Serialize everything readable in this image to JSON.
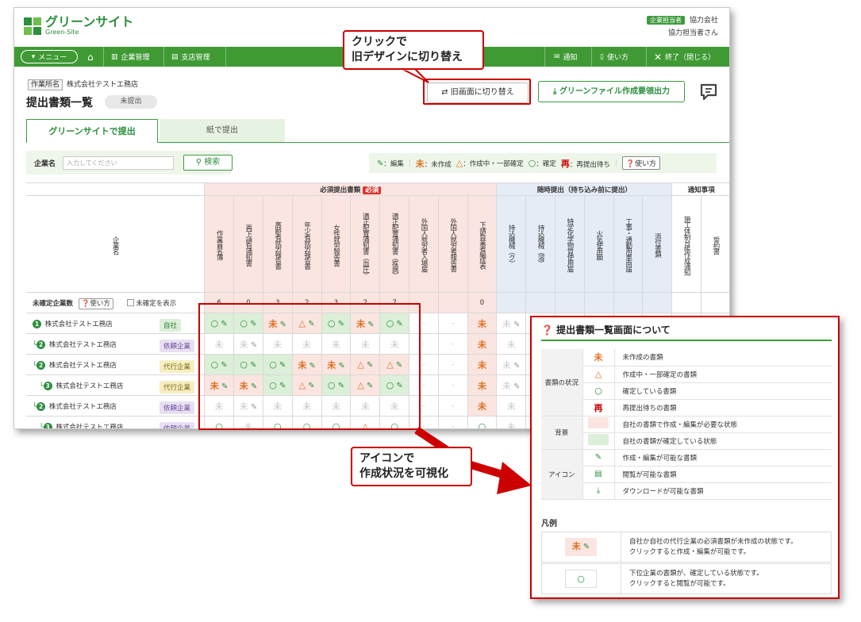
{
  "app": {
    "logo_text": "グリーンサイト",
    "logo_sub": "Green-Site",
    "brand_color": "#3f9a34"
  },
  "user": {
    "role_badge": "企業担当者",
    "company": "協力会社",
    "name": "協力担当者さん"
  },
  "nav": {
    "menu": "メニュー",
    "items": [
      "企業管理",
      "支店管理"
    ],
    "notify": "通知",
    "howto": "使い方",
    "exit": "終了（閉じる）"
  },
  "page": {
    "ws_label": "作業所名",
    "ws_name": "株式会社テストエ務店",
    "title": "提出書類一覧",
    "status": "未提出",
    "btn_old": "旧画面に切り替え",
    "btn_gf": "グリーンファイル作成要領出力"
  },
  "tabs": [
    "グリーンサイトで提出",
    "紙で提出"
  ],
  "search": {
    "label": "企業名",
    "placeholder": "入力してください",
    "button": "検索"
  },
  "legend": {
    "edit": "：編集",
    "mi": "未",
    "mi_label": "：未作成",
    "tri_label": "：作成中・一部確定",
    "ok_label": "：確定",
    "re": "再",
    "re_label": "：再提出待ち",
    "help": "使い方"
  },
  "grid": {
    "groups": {
      "required": "必須提出書類",
      "required_badge": "必須",
      "optional": "随時提出（持ち込み前に提出）",
      "notify": "通知事項"
    },
    "company_col": "企業名",
    "unconfirmed_label": "未確定企業数",
    "howto": "使い方",
    "show_unconfirmed": "未確定を表示",
    "columns": [
      "作業員名簿",
      "再下請負通知書",
      "高齢者就労報告書",
      "年少者就労報告書",
      "女性就労報告書",
      "適正配置通知書（血圧）",
      "適正配置通知書（疾病）",
      "外国人就労者入場届",
      "外国人就労者報告書",
      "下請負業者編成表",
      "持込機械（ク）",
      "持込機械（溶）",
      "特定化学物質使用届",
      "火気使用願",
      "工事・通勤用車両届",
      "添付書類",
      "施工体制台帳作成通知",
      "誓約書"
    ],
    "counts": [
      "6",
      "0",
      "3",
      "2",
      "3",
      "2",
      "7",
      "",
      "",
      "0",
      "",
      "",
      "",
      "",
      "",
      "",
      "",
      ""
    ],
    "rows": [
      {
        "num": "1",
        "indent": "",
        "name": "株式会社テストエ務店",
        "tag": "自社",
        "tagtype": "self",
        "cells": [
          [
            "o",
            "p",
            "g"
          ],
          [
            "o",
            "p",
            "g"
          ],
          [
            "m",
            "p",
            "p"
          ],
          [
            "t",
            "p",
            "p"
          ],
          [
            "o",
            "p",
            "g"
          ],
          [
            "m",
            "p",
            "p"
          ],
          [
            "o",
            "p",
            "g"
          ],
          [
            "-",
            "",
            ""
          ],
          [
            "-",
            "",
            ""
          ],
          [
            "m",
            "",
            "p"
          ],
          [
            "x",
            "pg",
            ""
          ],
          [
            "",
            "",
            " "
          ],
          [
            "",
            "",
            ""
          ],
          [
            "",
            "",
            ""
          ],
          [
            "",
            "",
            ""
          ],
          [
            "",
            "",
            ""
          ],
          [
            "",
            "",
            ""
          ],
          [
            "",
            "",
            ""
          ]
        ]
      },
      {
        "num": "2",
        "indent": "└",
        "name": "株式会社テストエ務店",
        "tag": "依頼企業",
        "tagtype": "req",
        "cells": [
          [
            "x",
            "",
            ""
          ],
          [
            "x",
            "pg",
            ""
          ],
          [
            "x",
            "",
            ""
          ],
          [
            "x",
            "",
            ""
          ],
          [
            "x",
            "",
            ""
          ],
          [
            "x",
            "",
            ""
          ],
          [
            "x",
            "",
            ""
          ],
          [
            "-",
            "",
            ""
          ],
          [
            "-",
            "",
            ""
          ],
          [
            "m",
            "",
            "p"
          ],
          [
            "x",
            "",
            ""
          ],
          [
            "",
            "",
            ""
          ],
          [
            "",
            "",
            ""
          ],
          [
            "",
            "",
            ""
          ],
          [
            "",
            "",
            ""
          ],
          [
            "",
            "",
            ""
          ],
          [
            "",
            "",
            ""
          ],
          [
            "",
            "",
            ""
          ]
        ]
      },
      {
        "num": "2",
        "indent": "└",
        "name": "株式会社テストエ務店",
        "tag": "代行企業",
        "tagtype": "agent",
        "cells": [
          [
            "o",
            "p",
            "g"
          ],
          [
            "o",
            "p",
            "g"
          ],
          [
            "o",
            "p",
            "g"
          ],
          [
            "m",
            "p",
            "p"
          ],
          [
            "m",
            "p",
            "p"
          ],
          [
            "t",
            "p",
            "p"
          ],
          [
            "t",
            "p",
            "p"
          ],
          [
            "-",
            "",
            ""
          ],
          [
            "-",
            "",
            ""
          ],
          [
            "m",
            "",
            "p"
          ],
          [
            "x",
            "pg",
            ""
          ],
          [
            "",
            "",
            ""
          ],
          [
            "",
            "",
            ""
          ],
          [
            "",
            "",
            ""
          ],
          [
            "",
            "",
            ""
          ],
          [
            "",
            "",
            ""
          ],
          [
            "",
            "",
            ""
          ],
          [
            "",
            "",
            ""
          ]
        ]
      },
      {
        "num": "3",
        "indent": "　└",
        "name": "株式会社テストエ務店",
        "tag": "代行企業",
        "tagtype": "agent",
        "cells": [
          [
            "m",
            "p",
            "p"
          ],
          [
            "m",
            "p",
            "p"
          ],
          [
            "o",
            "p",
            "g"
          ],
          [
            "t",
            "p",
            "p"
          ],
          [
            "o",
            "p",
            "g"
          ],
          [
            "t",
            "p",
            "p"
          ],
          [
            "o",
            "p",
            "g"
          ],
          [
            "-",
            "",
            ""
          ],
          [
            "-",
            "",
            ""
          ],
          [
            "m",
            "",
            "p"
          ],
          [
            "x",
            "pg",
            ""
          ],
          [
            "",
            "",
            ""
          ],
          [
            "",
            "",
            ""
          ],
          [
            "",
            "",
            ""
          ],
          [
            "",
            "",
            ""
          ],
          [
            "",
            "",
            ""
          ],
          [
            "",
            "",
            ""
          ],
          [
            "",
            "",
            ""
          ]
        ]
      },
      {
        "num": "2",
        "indent": "└",
        "name": "株式会社テストエ務店",
        "tag": "依頼企業",
        "tagtype": "req",
        "cells": [
          [
            "x",
            "",
            ""
          ],
          [
            "x",
            "pg",
            ""
          ],
          [
            "x",
            "",
            ""
          ],
          [
            "x",
            "",
            ""
          ],
          [
            "x",
            "",
            ""
          ],
          [
            "x",
            "",
            ""
          ],
          [
            "x",
            "",
            ""
          ],
          [
            "-",
            "",
            ""
          ],
          [
            "-",
            "",
            ""
          ],
          [
            "m",
            "",
            "p"
          ],
          [
            "x",
            "",
            ""
          ],
          [
            "",
            "",
            ""
          ],
          [
            "",
            "",
            ""
          ],
          [
            "",
            "",
            ""
          ],
          [
            "",
            "",
            ""
          ],
          [
            "",
            "",
            ""
          ],
          [
            "",
            "",
            ""
          ],
          [
            "",
            "",
            ""
          ]
        ]
      },
      {
        "num": "3",
        "indent": "　└",
        "name": "株式会社テストエ務店",
        "tag": "依頼企業",
        "tagtype": "req",
        "cells": [
          [
            "o",
            "",
            ""
          ],
          [
            "x",
            "",
            ""
          ],
          [
            "o",
            "",
            ""
          ],
          [
            "o",
            "",
            ""
          ],
          [
            "o",
            "",
            ""
          ],
          [
            "t",
            "",
            ""
          ],
          [
            "o",
            "",
            ""
          ],
          [
            "-",
            "",
            ""
          ],
          [
            "-",
            "",
            ""
          ],
          [
            "o",
            "",
            ""
          ],
          [
            "x",
            "",
            ""
          ],
          [
            "",
            "",
            ""
          ],
          [
            "",
            "",
            ""
          ],
          [
            "",
            "",
            ""
          ],
          [
            "",
            "",
            ""
          ],
          [
            "",
            "",
            ""
          ],
          [
            "",
            "",
            ""
          ],
          [
            "",
            "",
            ""
          ]
        ]
      }
    ]
  },
  "callouts": {
    "switch": [
      "クリックで",
      "旧デザインに切り替え"
    ],
    "visual": [
      "アイコンで",
      "作成状況を可視化"
    ]
  },
  "panel": {
    "title": "提出書類一覧画面について",
    "sections": [
      {
        "cat": "書類の状況",
        "items": [
          {
            "icon": "未",
            "desc": "未作成の書類"
          },
          {
            "icon": "△",
            "desc": "作成中・一部確定の書類"
          },
          {
            "icon": "○",
            "desc": "確定している書類"
          },
          {
            "icon": "再",
            "desc": "再提出待ちの書類"
          }
        ]
      },
      {
        "cat": "背景",
        "items": [
          {
            "icon": "",
            "desc": "自社の書類で作成・編集が必要な状態"
          },
          {
            "icon": "",
            "desc": "自社の書類が確定している状態"
          }
        ]
      },
      {
        "cat": "アイコン",
        "items": [
          {
            "icon": "",
            "desc": "作成・編集が可能な書類"
          },
          {
            "icon": "",
            "desc": "閲覧が可能な書類"
          },
          {
            "icon": "",
            "desc": "ダウンロードが可能な書類"
          }
        ]
      }
    ],
    "hanrei": "凡例",
    "example1": {
      "mark": "未",
      "text1": "自社か自社の代行企業の必須書類が未作成の状態です。",
      "text2": "クリックすると作成・編集が可能です。"
    },
    "example2": {
      "mark": "○",
      "text1": "下位企業の書類が、確定している状態です。",
      "text2": "クリックすると閲覧が可能です。"
    }
  },
  "colors": {
    "pink": "#fbe5e1",
    "green": "#dcefd8",
    "blue": "#e5ecf6",
    "red": "#cc0000",
    "orange": "#e07020"
  }
}
